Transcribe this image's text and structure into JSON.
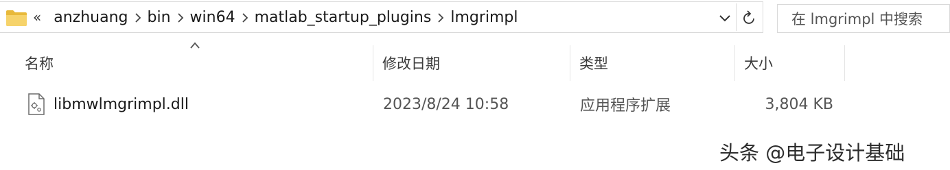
{
  "address_bar": {
    "overflow_glyph": "«",
    "crumbs": [
      "anzhuang",
      "bin",
      "win64",
      "matlab_startup_plugins",
      "lmgrimpl"
    ]
  },
  "search": {
    "placeholder": "在 lmgrimpl 中搜索"
  },
  "columns": {
    "name": "名称",
    "date_modified": "修改日期",
    "type": "类型",
    "size": "大小"
  },
  "files": [
    {
      "name": "libmwlmgrimpl.dll",
      "date_modified": "2023/8/24 10:58",
      "type": "应用程序扩展",
      "size": "3,804 KB"
    }
  ],
  "watermark": "头条 @电子设计基础",
  "icons": {
    "folder": "folder-icon",
    "file": "dll-file-icon",
    "chevron_down": "chevron-down-icon",
    "refresh": "refresh-icon",
    "sort_up": "sort-ascending-icon"
  },
  "colors": {
    "folder_yellow": "#F2C94C",
    "border": "#d9d9d9"
  }
}
